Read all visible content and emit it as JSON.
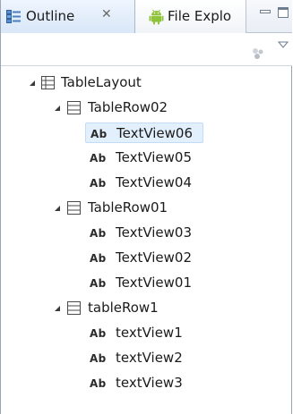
{
  "tabs": {
    "outline": {
      "label": "Outline",
      "close_glyph": "✕",
      "icon": "outline-icon"
    },
    "file_explorer": {
      "label": "File Explo",
      "icon": "android-icon"
    }
  },
  "window_controls": {
    "minimize": "minimize-icon",
    "maximize": "maximize-icon"
  },
  "toolbar": {
    "icons": [
      "filter-icon",
      "view-menu-icon"
    ]
  },
  "tree": {
    "root": {
      "label": "TableLayout",
      "children": [
        {
          "label": "TableRow02",
          "children": [
            {
              "label": "TextView06",
              "selected": true
            },
            {
              "label": "TextView05"
            },
            {
              "label": "TextView04"
            }
          ]
        },
        {
          "label": "TableRow01",
          "children": [
            {
              "label": "TextView03"
            },
            {
              "label": "TextView02"
            },
            {
              "label": "TextView01"
            }
          ]
        },
        {
          "label": "tableRow1",
          "children": [
            {
              "label": "textView1"
            },
            {
              "label": "textView2"
            },
            {
              "label": "textView3"
            }
          ]
        }
      ]
    },
    "text_view_badge": "Ab"
  },
  "colors": {
    "selection_bg": "#e2effc",
    "selection_border": "#c3dcf5",
    "tab_active": "#d9e7f8"
  }
}
